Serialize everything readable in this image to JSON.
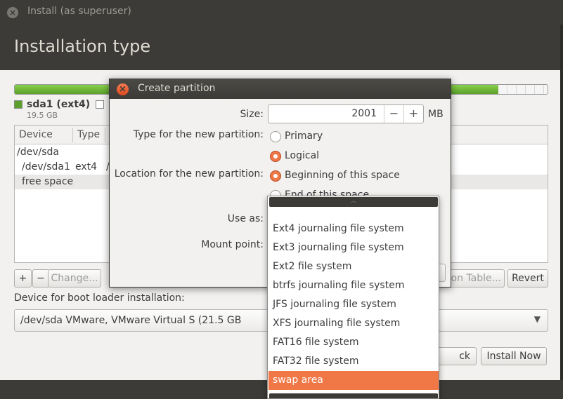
{
  "window": {
    "title": "Install (as superuser)",
    "heading": "Installation type"
  },
  "partitions": {
    "bar": {
      "used_fraction": 0.907
    },
    "legend": [
      {
        "label": "sda1 (ext4)",
        "size": "19.5 GB",
        "color": "#5aa02a"
      }
    ]
  },
  "table": {
    "columns": [
      "Device",
      "Type"
    ],
    "rows": [
      {
        "device": "/dev/sda",
        "type": ""
      },
      {
        "device": "/dev/sda1",
        "type": "ext4"
      },
      {
        "device": "free space",
        "type": ""
      }
    ]
  },
  "actions": {
    "add": "+",
    "remove": "−",
    "change": "Change...",
    "new_table": "ion Table...",
    "revert": "Revert"
  },
  "boot": {
    "label": "Device for boot loader installation:",
    "value": "/dev/sda   VMware, VMware Virtual S (21.5 GB"
  },
  "footer_buttons": {
    "back": "ck",
    "install": "Install Now"
  },
  "dialog": {
    "title": "Create partition",
    "size_label": "Size:",
    "size_value": "2001",
    "size_unit": "MB",
    "type_label": "Type for the new partition:",
    "type_options": [
      "Primary",
      "Logical"
    ],
    "type_selected": "Logical",
    "location_label": "Location for the new partition:",
    "location_options": [
      "Beginning of this space",
      "End of this space"
    ],
    "location_selected": "Beginning of this space",
    "use_as_label": "Use as:",
    "mount_label": "Mount point:"
  },
  "use_as_dropdown": {
    "options": [
      "Ext4 journaling file system",
      "Ext3 journaling file system",
      "Ext2 file system",
      "btrfs journaling file system",
      "JFS journaling file system",
      "XFS journaling file system",
      "FAT16 file system",
      "FAT32 file system",
      "swap area"
    ],
    "highlighted": "swap area",
    "accent_color": "#f07746"
  }
}
